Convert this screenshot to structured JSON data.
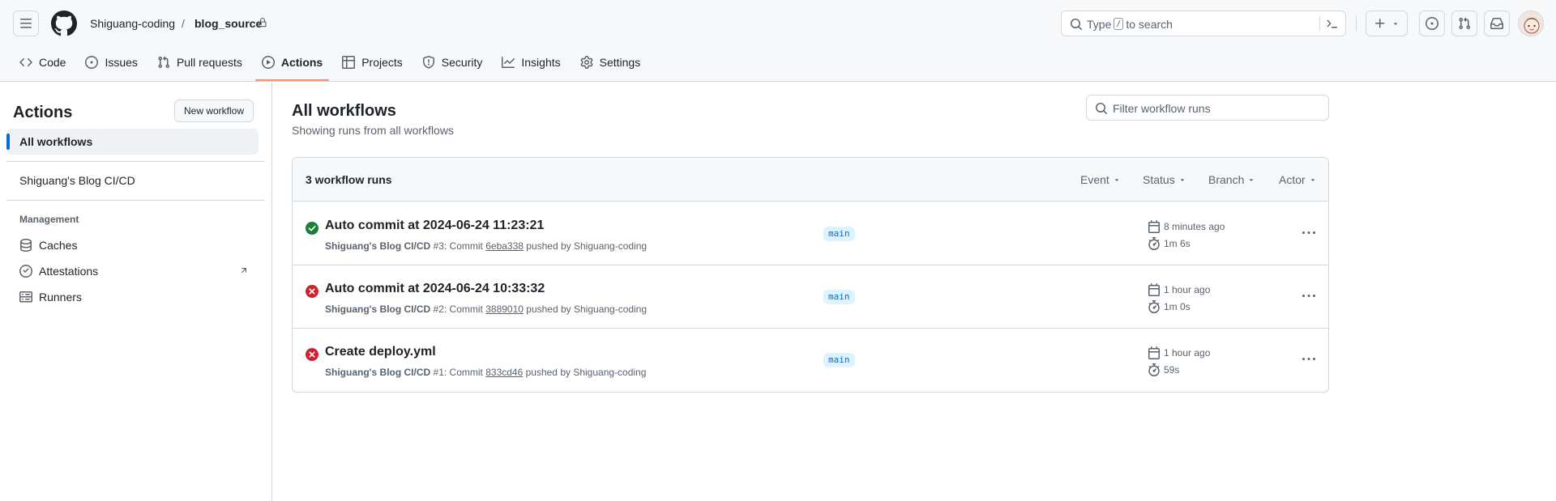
{
  "colors": {
    "accent": "#0969da",
    "success": "#1a7f37",
    "danger": "#cf222e",
    "tab_underline": "#fd8c73"
  },
  "header": {
    "owner": "Shiguang-coding",
    "separator": "/",
    "repo": "blog_source",
    "search": {
      "before": "Type",
      "key": "/",
      "after": "to search"
    }
  },
  "tabs": [
    {
      "label": "Code",
      "icon": "code-icon"
    },
    {
      "label": "Issues",
      "icon": "issue-opened-icon"
    },
    {
      "label": "Pull requests",
      "icon": "git-pull-request-icon"
    },
    {
      "label": "Actions",
      "icon": "play-icon",
      "active": true
    },
    {
      "label": "Projects",
      "icon": "table-icon"
    },
    {
      "label": "Security",
      "icon": "shield-icon"
    },
    {
      "label": "Insights",
      "icon": "graph-icon"
    },
    {
      "label": "Settings",
      "icon": "gear-icon"
    }
  ],
  "sidebar": {
    "title": "Actions",
    "new_workflow": "New workflow",
    "all_workflows": "All workflows",
    "workflow": "Shiguang's Blog CI/CD",
    "management_label": "Management",
    "management": [
      {
        "label": "Caches",
        "icon": "database-icon"
      },
      {
        "label": "Attestations",
        "icon": "verified-icon"
      },
      {
        "label": "Runners",
        "icon": "server-icon"
      }
    ]
  },
  "main": {
    "title": "All workflows",
    "subtitle": "Showing runs from all workflows",
    "filter_placeholder": "Filter workflow runs",
    "runs_count": "3 workflow runs",
    "filters": [
      "Event",
      "Status",
      "Branch",
      "Actor"
    ],
    "runs": [
      {
        "status": "success",
        "title": "Auto commit at 2024-06-24 11:23:21",
        "workflow": "Shiguang's Blog CI/CD",
        "number": "#3",
        "commit_text": ": Commit ",
        "sha": "6eba338",
        "pushed_by": " pushed by Shiguang-coding",
        "branch": "main",
        "when": "8 minutes ago",
        "duration": "1m 6s"
      },
      {
        "status": "failure",
        "title": "Auto commit at 2024-06-24 10:33:32",
        "workflow": "Shiguang's Blog CI/CD",
        "number": "#2",
        "commit_text": ": Commit ",
        "sha": "3889010",
        "pushed_by": " pushed by Shiguang-coding",
        "branch": "main",
        "when": "1 hour ago",
        "duration": "1m 0s"
      },
      {
        "status": "failure",
        "title": "Create deploy.yml",
        "workflow": "Shiguang's Blog CI/CD",
        "number": "#1",
        "commit_text": ": Commit ",
        "sha": "833cd46",
        "pushed_by": " pushed by Shiguang-coding",
        "branch": "main",
        "when": "1 hour ago",
        "duration": "59s"
      }
    ]
  }
}
